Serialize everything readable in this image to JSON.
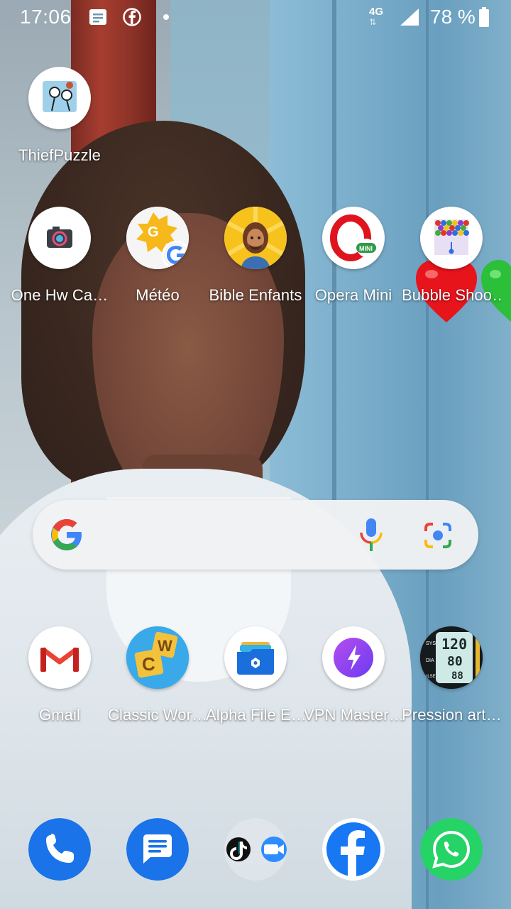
{
  "status_bar": {
    "time": "17:06",
    "network": "4G",
    "battery": "78 %",
    "icons": [
      "messages-notification-icon",
      "facebook-notification-icon",
      "more-notifications-dot",
      "signal-icon",
      "battery-icon"
    ]
  },
  "wallpaper": {
    "description_icons": [
      "red-heart-emoji",
      "green-heart-emoji"
    ]
  },
  "apps_top": [
    {
      "label": "ThiefPuzzle",
      "icon": "thiefpuzzle-icon"
    }
  ],
  "apps_row2": [
    {
      "label": "One Hw Ca…",
      "icon": "camera-icon"
    },
    {
      "label": "Météo",
      "icon": "weather-icon"
    },
    {
      "label": "Bible Enfants",
      "icon": "bible-kids-icon"
    },
    {
      "label": "Opera Mini",
      "icon": "opera-mini-icon"
    },
    {
      "label": "Bubble Shoo…",
      "icon": "bubble-shooter-icon"
    }
  ],
  "search": {
    "icons": [
      "google-g-icon",
      "microphone-icon",
      "google-lens-icon"
    ]
  },
  "apps_row3": [
    {
      "label": "Gmail",
      "icon": "gmail-icon"
    },
    {
      "label": "Classic Wor…",
      "icon": "classic-words-icon"
    },
    {
      "label": "Alpha File E…",
      "icon": "file-explorer-icon"
    },
    {
      "label": "VPN Master…",
      "icon": "vpn-icon"
    },
    {
      "label": "Pression art…",
      "icon": "blood-pressure-icon"
    }
  ],
  "dock": [
    {
      "name": "phone",
      "icon": "phone-icon"
    },
    {
      "name": "messages",
      "icon": "messages-icon"
    },
    {
      "name": "folder",
      "icon": "tiktok-zoom-folder-icon"
    },
    {
      "name": "facebook",
      "icon": "facebook-icon"
    },
    {
      "name": "whatsapp",
      "icon": "whatsapp-icon"
    }
  ],
  "colors": {
    "google_blue": "#4285F4",
    "google_red": "#EA4335",
    "google_yellow": "#FBBC05",
    "google_green": "#34A853",
    "phone_blue": "#1a73e8",
    "facebook_blue": "#1877F2",
    "whatsapp_green": "#25D366"
  }
}
